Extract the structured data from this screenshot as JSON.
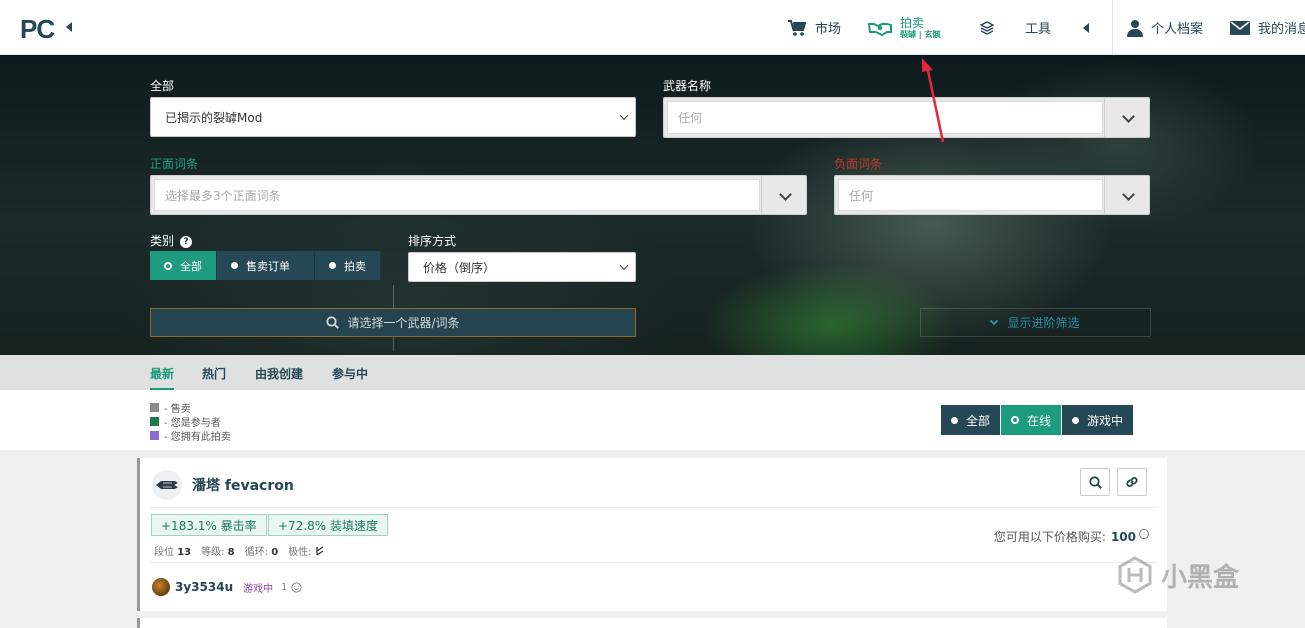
{
  "nav": {
    "logo": "PC",
    "market": "市场",
    "auction_main": "拍卖",
    "auction_sub": "裂罅 | 玄骸",
    "tools": "工具",
    "profile": "个人档案",
    "messages": "我的消息"
  },
  "filters": {
    "all_label": "全部",
    "all_value": "已揭示的裂罅Mod",
    "weapon_label": "武器名称",
    "weapon_placeholder": "任何",
    "positive_label": "正面词条",
    "positive_placeholder": "选择最多3个正面词条",
    "negative_label": "负面词条",
    "negative_placeholder": "任何",
    "category_label": "类别",
    "category_help": "?",
    "category_options": [
      "全部",
      "售卖订单",
      "拍卖"
    ],
    "sort_label": "排序方式",
    "sort_value": "价格（倒序）",
    "search_button": "请选择一个武器/词条",
    "advanced_button": "显示进阶筛选"
  },
  "tabs": [
    "最新",
    "热门",
    "由我创建",
    "参与中"
  ],
  "legend": [
    {
      "text": "- 售卖",
      "color": "#8a8a8a"
    },
    {
      "text": "- 您是参与者",
      "color": "#1d7a4a"
    },
    {
      "text": "- 您拥有此拍卖",
      "color": "#8e6ad1"
    }
  ],
  "status_options": [
    "全部",
    "在线",
    "游戏中"
  ],
  "auction": {
    "title": "潘塔 fevacron",
    "stats": [
      "+183.1% 暴击率",
      "+72.8% 装填速度"
    ],
    "meta": {
      "rank_label": "段位",
      "rank": "13",
      "level_label": "等级:",
      "level": "8",
      "cycles_label": "循环:",
      "cycles": "0",
      "polarity_label": "极性:"
    },
    "price_label": "您可用以下价格购买:",
    "price": "100",
    "seller": "3y3534u",
    "seller_status": "游戏中",
    "seller_rep": "1"
  },
  "watermark": "小黑盒",
  "colors": {
    "accent": "#1d9b7f",
    "navy": "#264755",
    "negative": "#c0392b",
    "annotation": "#e8243a"
  }
}
